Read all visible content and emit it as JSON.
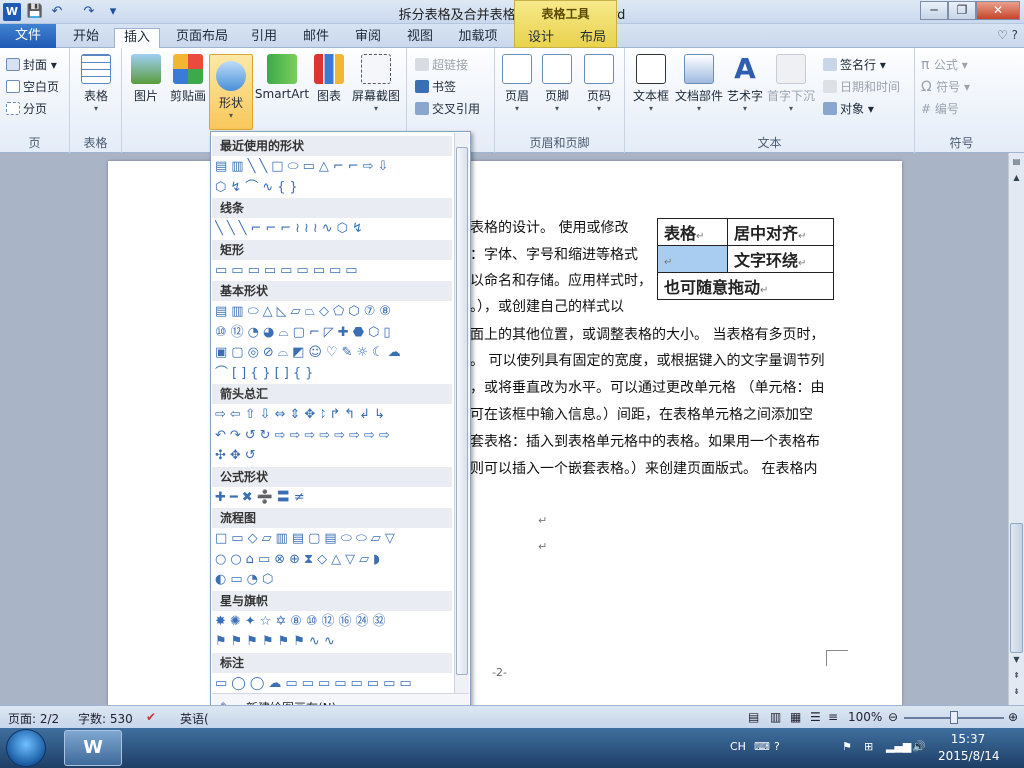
{
  "window": {
    "title": "拆分表格及合并表格 - Microsoft Word",
    "context_group": "表格工具",
    "controls": {
      "minimize": "─",
      "maximize": "❐",
      "close": "✕"
    }
  },
  "qat": {
    "logo": "W",
    "save": "💾",
    "undo": "↶",
    "redo": "↷",
    "more": "▾"
  },
  "tabs": {
    "file": "文件",
    "home": "开始",
    "insert": "插入",
    "page_layout": "页面布局",
    "references": "引用",
    "mailings": "邮件",
    "review": "审阅",
    "view": "视图",
    "addins": "加载项",
    "design": "设计",
    "layout": "布局",
    "help_icons": "♡ ?"
  },
  "ribbon": {
    "pages": {
      "label": "页",
      "cover": "封面",
      "blank": "空白页",
      "break": "分页"
    },
    "tables": {
      "label": "表格",
      "table": "表格"
    },
    "illustrations": {
      "picture": "图片",
      "clipart": "剪贴画",
      "shapes": "形状",
      "smartart": "SmartArt",
      "chart": "图表",
      "screenshot": "屏幕截图"
    },
    "links": {
      "hyperlink": "超链接",
      "bookmark": "书签",
      "crossref": "交叉引用"
    },
    "header_footer": {
      "label": "页眉和页脚",
      "header": "页眉",
      "footer": "页脚",
      "page_number": "页码"
    },
    "text": {
      "label": "文本",
      "textbox": "文本框",
      "quickparts": "文档部件",
      "wordart": "艺术字",
      "dropcap": "首字下沉",
      "signature": "签名行",
      "datetime": "日期和时间",
      "object": "对象"
    },
    "symbols": {
      "label": "符号",
      "equation": "公式",
      "symbol": "符号",
      "number": "编号"
    }
  },
  "document": {
    "lines": [
      "表格的设计。 使用或修改",
      "：字体、字号和缩进等格式",
      "以命名和存储。应用样式时，",
      "。），或创建自己的样式以",
      "面上的其他位置，或调整表格的大小。 当表格有多页时，",
      "。 可以使列具有固定的宽度，或根据键入的文字量调节列",
      "，或将垂直改为水平。可以通过更改单元格 （单元格：由",
      "可在该框中输入信息。）间距，在表格单元格之间添加空",
      "套表格：插入到表格单元格中的表格。如果用一个表格布",
      "则可以插入一个嵌套表格。）来创建页面版式。 在表格内"
    ],
    "table": {
      "row1": [
        "表格",
        "居中对齐"
      ],
      "row2": [
        "",
        "文字环绕"
      ],
      "row3": "也可随意拖动"
    },
    "para_mark": "↵",
    "page_number": "-2-"
  },
  "shapes_panel": {
    "sections": [
      {
        "title": "最近使用的形状",
        "rows": [
          "▤▥╲╲□⬭▭△⌐⌐⇨⇩",
          "⬡↯⌒∿{}"
        ]
      },
      {
        "title": "线条",
        "rows": [
          "╲╲╲⌐⌐⌐≀≀≀∿⬡↯"
        ]
      },
      {
        "title": "矩形",
        "rows": [
          "▭▭▭▭▭▭▭▭▭"
        ]
      },
      {
        "title": "基本形状",
        "rows": [
          "▤▥⬭△◺▱⏢◇⬠⬡⑦⑧",
          "⑩⑫◔◕⌓▢⌐◸✚⬣⬡▯",
          "▣▢◎⊘⌓◩☺♡✎☼☾☁",
          "⌒[]{}[]{}"
        ]
      },
      {
        "title": "箭头总汇",
        "rows": [
          "⇨⇦⇧⇩⇔⇕✥⥏↱↰↲↳",
          "↶↷↺↻⇨⇨⇨⇨⇨⇨⇨⇨",
          "✣✥↺"
        ]
      },
      {
        "title": "公式形状",
        "rows": [
          "✚━✖➗〓≠"
        ]
      },
      {
        "title": "流程图",
        "rows": [
          "□▭◇▱▥▤▢▤⬭⬭▱▽",
          "○○⌂▭⊗⊕⧗◇△▽▱◗",
          "◐▭◔⬡"
        ]
      },
      {
        "title": "星与旗帜",
        "rows": [
          "✸✺✦☆✡⑧⑩⑫⑯㉔㉜",
          "⚑⚑⚑⚑⚑⚑∿∿"
        ]
      },
      {
        "title": "标注",
        "rows": [
          "▭◯◯☁▭▭▭▭▭▭▭▭"
        ]
      }
    ],
    "footer": "新建绘图画布(N)"
  },
  "statusbar": {
    "page": "页面: 2/2",
    "words": "字数: 530",
    "language": "英语(",
    "zoom": "100%",
    "zoom_fraction": 0.5
  },
  "taskbar": {
    "word_button": "W",
    "lang": "CH",
    "time": "15:37",
    "date": "2015/8/14"
  },
  "colors": {
    "file_tab": "#1f5ab3",
    "context_tab": "#e9d24c",
    "shape_highlight": "#f8c85b",
    "shape_glyph": "#3a6fb3"
  }
}
